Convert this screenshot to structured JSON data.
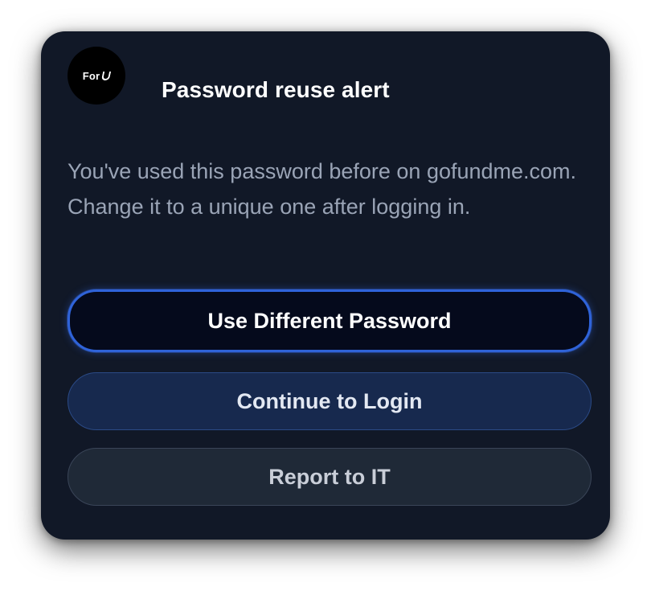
{
  "alert": {
    "logo_text": "For",
    "title": "Password reuse alert",
    "message": "You've used this password before on gofundme.com. Change it to a unique one after logging in."
  },
  "actions": {
    "primary_label": "Use Different Password",
    "secondary_label": "Continue to Login",
    "tertiary_label": "Report to IT"
  },
  "colors": {
    "card_background": "#111827",
    "primary_border": "#2f63d9",
    "secondary_background": "#17294e",
    "tertiary_background": "#1f2937"
  }
}
